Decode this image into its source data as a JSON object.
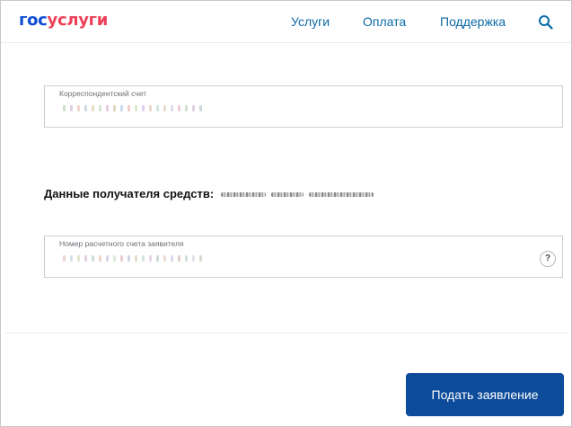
{
  "header": {
    "logo_part1": "гос",
    "logo_part2": "услуги",
    "nav": [
      "Услуги",
      "Оплата",
      "Поддержка"
    ]
  },
  "form": {
    "correspondent_account": {
      "label": "Корреспондентский счет"
    },
    "recipient": {
      "label": "Данные получателя средств:"
    },
    "applicant_account": {
      "label": "Номер расчетного счета заявителя",
      "help": "?"
    },
    "submit_label": "Подать заявление"
  },
  "colors": {
    "logo_blue": "#0d4cd3",
    "logo_red": "#ee3f58",
    "nav_link": "#0b6aa8",
    "button_bg": "#0d4c9a"
  },
  "icons": {
    "search": "search-icon",
    "help": "question-icon"
  }
}
